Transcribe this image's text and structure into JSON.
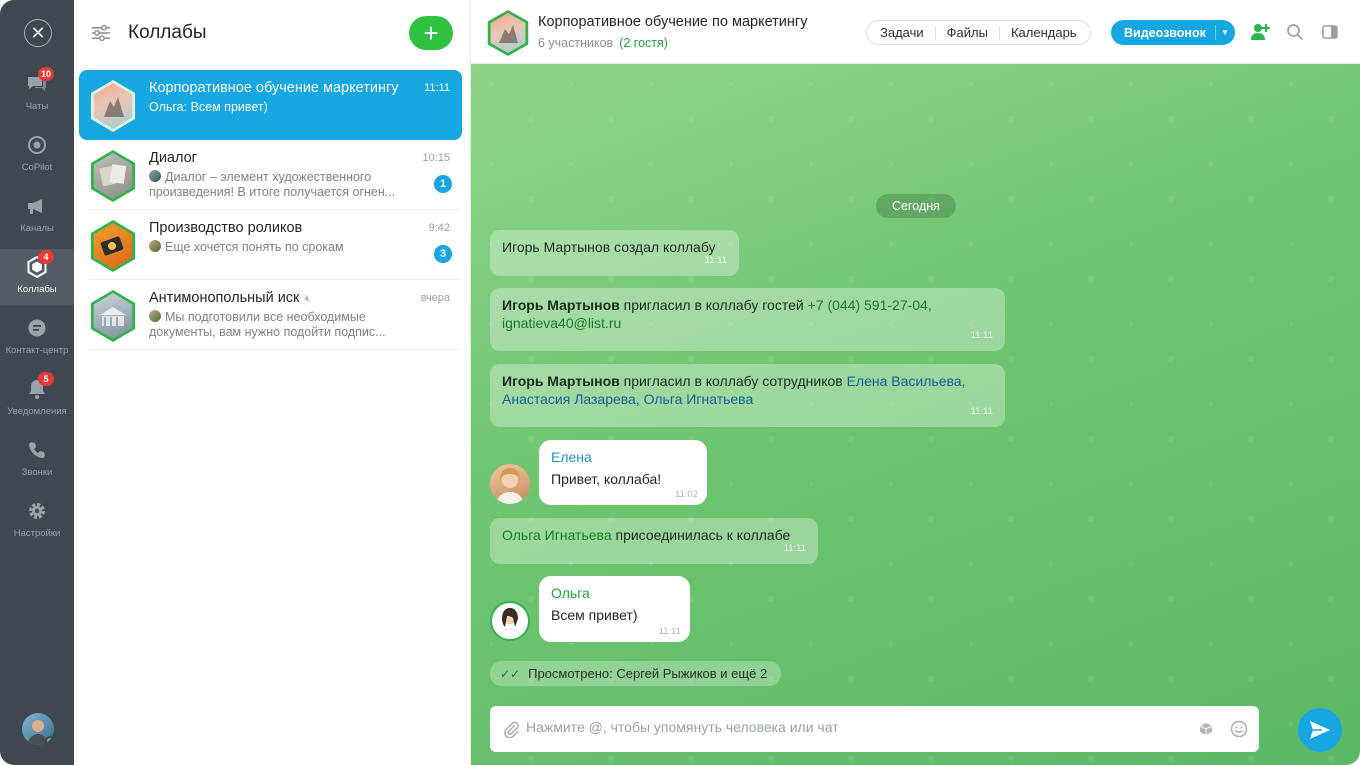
{
  "rail": {
    "items": [
      {
        "label": "Чаты",
        "badge": "10"
      },
      {
        "label": "CoPilot",
        "badge": ""
      },
      {
        "label": "Каналы",
        "badge": ""
      },
      {
        "label": "Коллабы",
        "badge": "4"
      },
      {
        "label": "Контакт-центр",
        "badge": ""
      },
      {
        "label": "Уведомления",
        "badge": "5"
      },
      {
        "label": "Звонки",
        "badge": ""
      },
      {
        "label": "Настройки",
        "badge": ""
      }
    ]
  },
  "list": {
    "title": "Коллабы",
    "add_label": "+",
    "chats": [
      {
        "name": "Корпоративное обучение маркетингу",
        "time": "11:11",
        "preview": "Ольга: Всем привет)",
        "unread": ""
      },
      {
        "name": "Диалог",
        "time": "10:15",
        "preview": "Диалог – элемент художественного произведения! В итоге получается огнен...",
        "unread": "1"
      },
      {
        "name": "Производство роликов",
        "time": "9:42",
        "preview": "Еще хочется понять по срокам",
        "unread": "3"
      },
      {
        "name": "Антимонопольный иск",
        "time": "вчера",
        "preview": "Мы подготовили все необходимые документы, вам нужно подойти подпис...",
        "unread": ""
      }
    ]
  },
  "header": {
    "title": "Корпоративное обучение по маркетингу",
    "participants": "6 участников",
    "guests": "(2 гостя)",
    "tabs": [
      "Задачи",
      "Файлы",
      "Календарь"
    ],
    "video_call": "Видеозвонок"
  },
  "chat": {
    "day": "Сегодня",
    "sys1": {
      "actor": "Игорь Мартынов",
      "text": " создал коллабу",
      "time": "11:11"
    },
    "sys2": {
      "actor": "Игорь Мартынов",
      "text": " пригласил в коллабу гостей ",
      "guest1": "+7 (044) 591-27-04,",
      "guest2": "ignatieva40@list.ru",
      "time": "11:11"
    },
    "sys3": {
      "actor": "Игорь Мартынов",
      "text": " пригласил в коллабу сотрудников ",
      "emp1": "Елена Васильева,",
      "emp2": "Анастасия Лазарева,",
      "emp3": "Ольга Игнатьева",
      "time": "11:11"
    },
    "msg1": {
      "author": "Елена",
      "text": "Привет, коллаба!",
      "time": "11:02"
    },
    "sys4": {
      "actor": "Ольга Игнатьева",
      "text": " присоединилась к коллабе",
      "time": "11:11"
    },
    "msg2": {
      "author": "Ольга",
      "text": "Всем привет)",
      "time": "11:11"
    },
    "seen": "Просмотрено: Сергей Рыжиков и ещё 2"
  },
  "composer": {
    "placeholder": "Нажмите @, чтобы упомянуть человека или чат"
  },
  "colors": {
    "accent_blue": "#16a6e1",
    "accent_green": "#2fc140",
    "badge_red": "#e53935",
    "rail_bg": "#3f4751"
  }
}
